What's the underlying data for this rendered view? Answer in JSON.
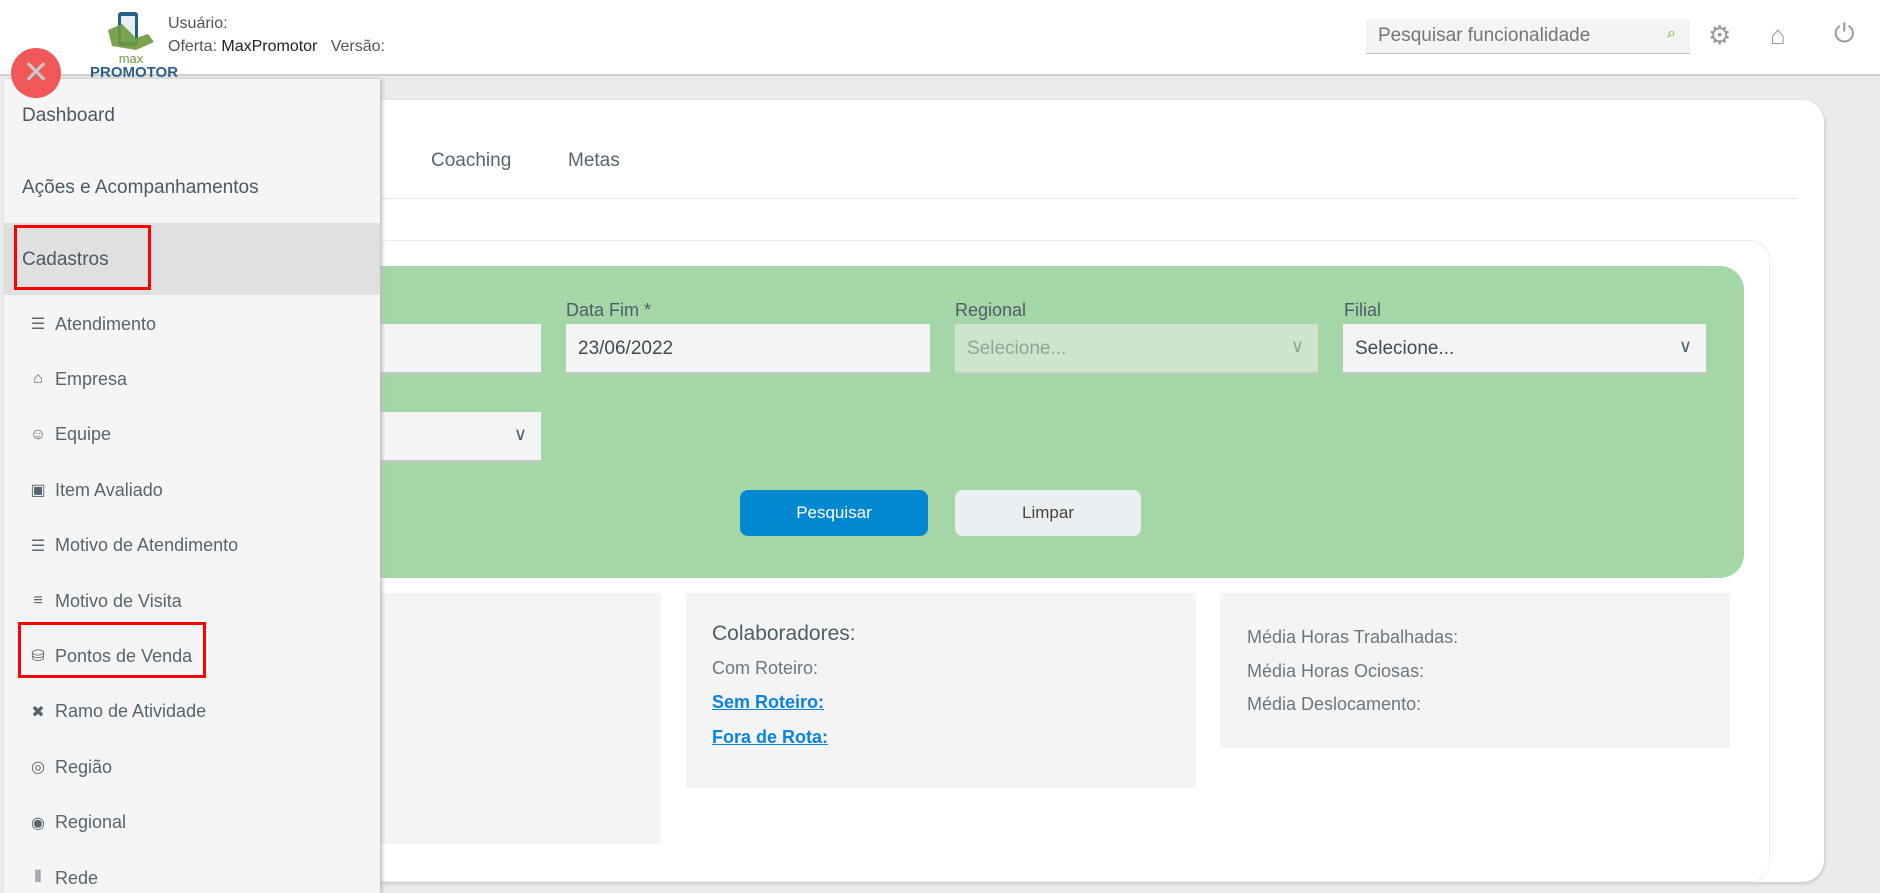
{
  "header": {
    "logo_text_top": "max",
    "logo_text_bottom": "PROMOTOR",
    "user_label": "Usuário:",
    "offer_label": "Oferta:",
    "offer_value": "MaxPromotor",
    "version_label": "Versão:",
    "search_placeholder": "Pesquisar funcionalidade"
  },
  "tabs": [
    "Coaching",
    "Metas"
  ],
  "filters": {
    "data_fim_label": "Data Fim *",
    "data_fim_value": "23/06/2022",
    "regional_label": "Regional",
    "regional_value": "Selecione...",
    "filial_label": "Filial",
    "filial_value": "Selecione...",
    "search_button": "Pesquisar",
    "clear_button": "Limpar"
  },
  "stats": {
    "colaboradores_title": "Colaboradores:",
    "com_roteiro": "Com Roteiro:",
    "sem_roteiro": "Sem Roteiro:",
    "fora_de_rota": "Fora de Rota:",
    "media_horas_trabalhadas": "Média Horas Trabalhadas:",
    "media_horas_ociosas": "Média Horas Ociosas:",
    "media_deslocamento": "Média Deslocamento:"
  },
  "sidebar": {
    "items": [
      "Dashboard",
      "Ações e Acompanhamentos",
      "Cadastros"
    ],
    "sub_items": [
      {
        "label": "Atendimento",
        "icon": "list-icon"
      },
      {
        "label": "Empresa",
        "icon": "home-icon"
      },
      {
        "label": "Equipe",
        "icon": "users-icon"
      },
      {
        "label": "Item Avaliado",
        "icon": "cube-icon"
      },
      {
        "label": "Motivo de Atendimento",
        "icon": "list-icon"
      },
      {
        "label": "Motivo de Visita",
        "icon": "bars-icon"
      },
      {
        "label": "Pontos de Venda",
        "icon": "database-icon"
      },
      {
        "label": "Ramo de Atividade",
        "icon": "expand-icon"
      },
      {
        "label": "Região",
        "icon": "globe-icon"
      },
      {
        "label": "Regional",
        "icon": "compass-icon"
      },
      {
        "label": "Rede",
        "icon": "sliders-icon"
      }
    ]
  }
}
